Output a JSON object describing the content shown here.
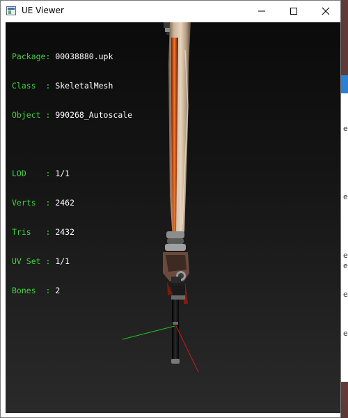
{
  "window": {
    "title": "UE Viewer",
    "controls": {
      "minimize": "minimize-icon",
      "maximize": "maximize-icon",
      "close": "close-icon"
    }
  },
  "info": {
    "package": {
      "label": "Package: ",
      "value": "00038880.upk"
    },
    "class": {
      "label": "Class  : ",
      "value": "SkeletalMesh"
    },
    "object": {
      "label": "Object : ",
      "value": "990268_Autoscale"
    },
    "lod": {
      "label": "LOD    : ",
      "value": "1/1"
    },
    "verts": {
      "label": "Verts  : ",
      "value": "2462"
    },
    "tris": {
      "label": "Tris   : ",
      "value": "2432"
    },
    "uvset": {
      "label": "UV Set : ",
      "value": "1/1"
    },
    "bones": {
      "label": "Bones  : ",
      "value": "2"
    }
  },
  "colors": {
    "label_green": "#3fd43f",
    "value_white": "#ffffff",
    "axis_x": "#d01818",
    "axis_y": "#22c422",
    "blade_core": "#d8561a"
  },
  "background_window": {
    "marks": [
      "e",
      "e",
      "e",
      "e",
      "e",
      "e"
    ]
  }
}
